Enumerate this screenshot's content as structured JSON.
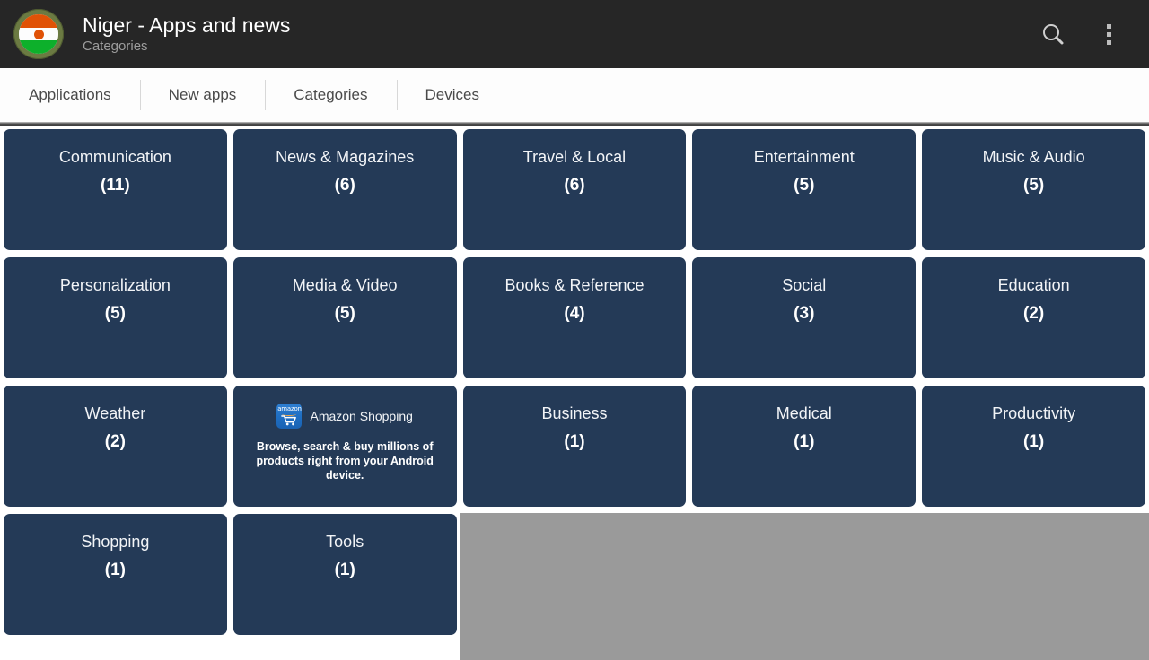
{
  "header": {
    "title": "Niger - Apps and news",
    "subtitle": "Categories",
    "app_icon_name": "niger-flag-icon",
    "search_icon": "search-icon",
    "overflow_icon": "overflow-menu-icon",
    "background_color": "#262626",
    "title_color": "#ffffff",
    "subtitle_color": "#9d9d9d"
  },
  "tabs": [
    {
      "label": "Applications",
      "selected": false
    },
    {
      "label": "New apps",
      "selected": false
    },
    {
      "label": "Categories",
      "selected": true
    },
    {
      "label": "Devices",
      "selected": false
    }
  ],
  "grid": {
    "tile_color": "#243a57",
    "empty_color": "#9a9a9a",
    "tiles": [
      {
        "type": "category",
        "label": "Communication",
        "count": "(11)"
      },
      {
        "type": "category",
        "label": "News & Magazines",
        "count": "(6)"
      },
      {
        "type": "category",
        "label": "Travel & Local",
        "count": "(6)"
      },
      {
        "type": "category",
        "label": "Entertainment",
        "count": "(5)"
      },
      {
        "type": "category",
        "label": "Music & Audio",
        "count": "(5)"
      },
      {
        "type": "category",
        "label": "Personalization",
        "count": "(5)"
      },
      {
        "type": "category",
        "label": "Media & Video",
        "count": "(5)"
      },
      {
        "type": "category",
        "label": "Books & Reference",
        "count": "(4)"
      },
      {
        "type": "category",
        "label": "Social",
        "count": "(3)"
      },
      {
        "type": "category",
        "label": "Education",
        "count": "(2)"
      },
      {
        "type": "category",
        "label": "Weather",
        "count": "(2)"
      },
      {
        "type": "ad",
        "label": "Amazon Shopping",
        "body": "Browse, search & buy millions of products right from your Android device.",
        "icon_name": "amazon-shopping-icon"
      },
      {
        "type": "category",
        "label": "Business",
        "count": "(1)"
      },
      {
        "type": "category",
        "label": "Medical",
        "count": "(1)"
      },
      {
        "type": "category",
        "label": "Productivity",
        "count": "(1)"
      },
      {
        "type": "category",
        "label": "Shopping",
        "count": "(1)"
      },
      {
        "type": "category",
        "label": "Tools",
        "count": "(1)"
      }
    ]
  }
}
